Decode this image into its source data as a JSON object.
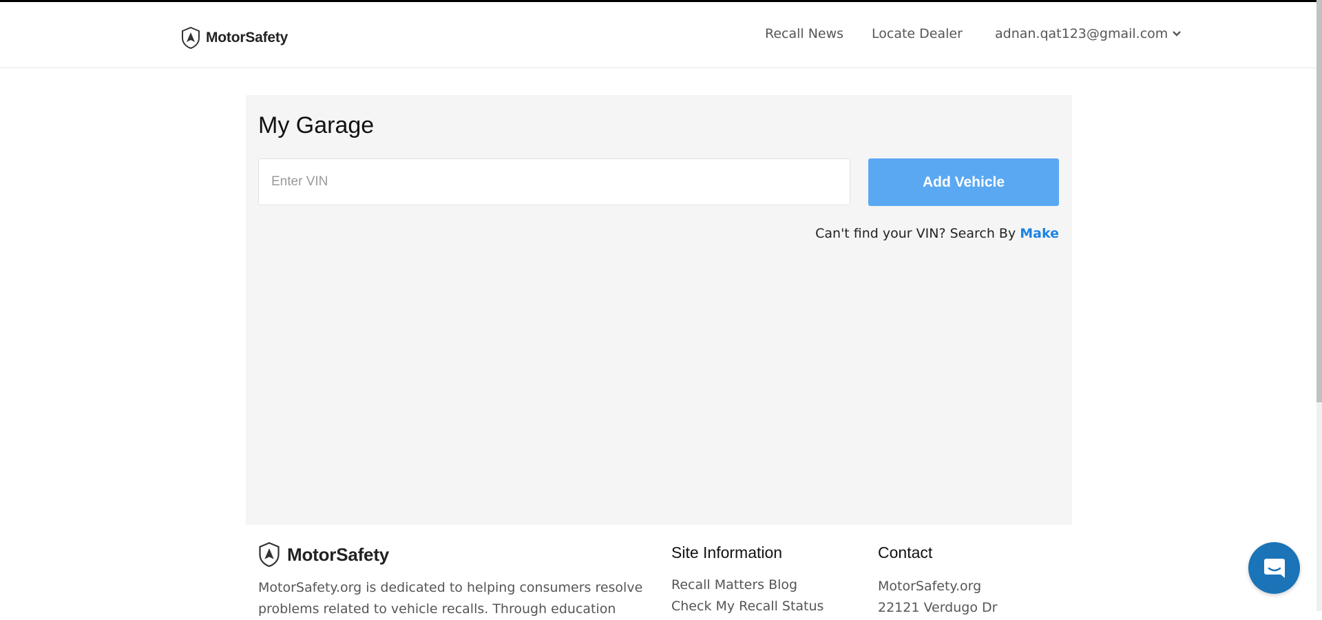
{
  "header": {
    "logo_text": "MotorSafety",
    "nav": {
      "recall_news": "Recall News",
      "locate_dealer": "Locate Dealer",
      "user_email": "adnan.qat123@gmail.com"
    }
  },
  "garage": {
    "title": "My Garage",
    "vin_placeholder": "Enter VIN",
    "vin_value": "",
    "add_button": "Add Vehicle",
    "search_prompt": "Can't find your VIN? Search By",
    "search_link": "Make"
  },
  "footer": {
    "logo_text": "MotorSafety",
    "description": "MotorSafety.org is dedicated to helping consumers resolve problems related to vehicle recalls. Through education",
    "site_information": {
      "title": "Site Information",
      "links": [
        "Recall Matters Blog",
        "Check My Recall Status"
      ]
    },
    "contact": {
      "title": "Contact",
      "lines": [
        "MotorSafety.org",
        "22121 Verdugo Dr"
      ]
    }
  },
  "icons": {
    "logo": "shield-logo-icon",
    "dropdown": "chevron-down-icon",
    "chat": "chat-bubble-icon"
  },
  "colors": {
    "accent_button": "#5aa8f2",
    "link": "#1a84e5",
    "chat": "#1b74b8",
    "panel_bg": "#f5f5f5"
  }
}
